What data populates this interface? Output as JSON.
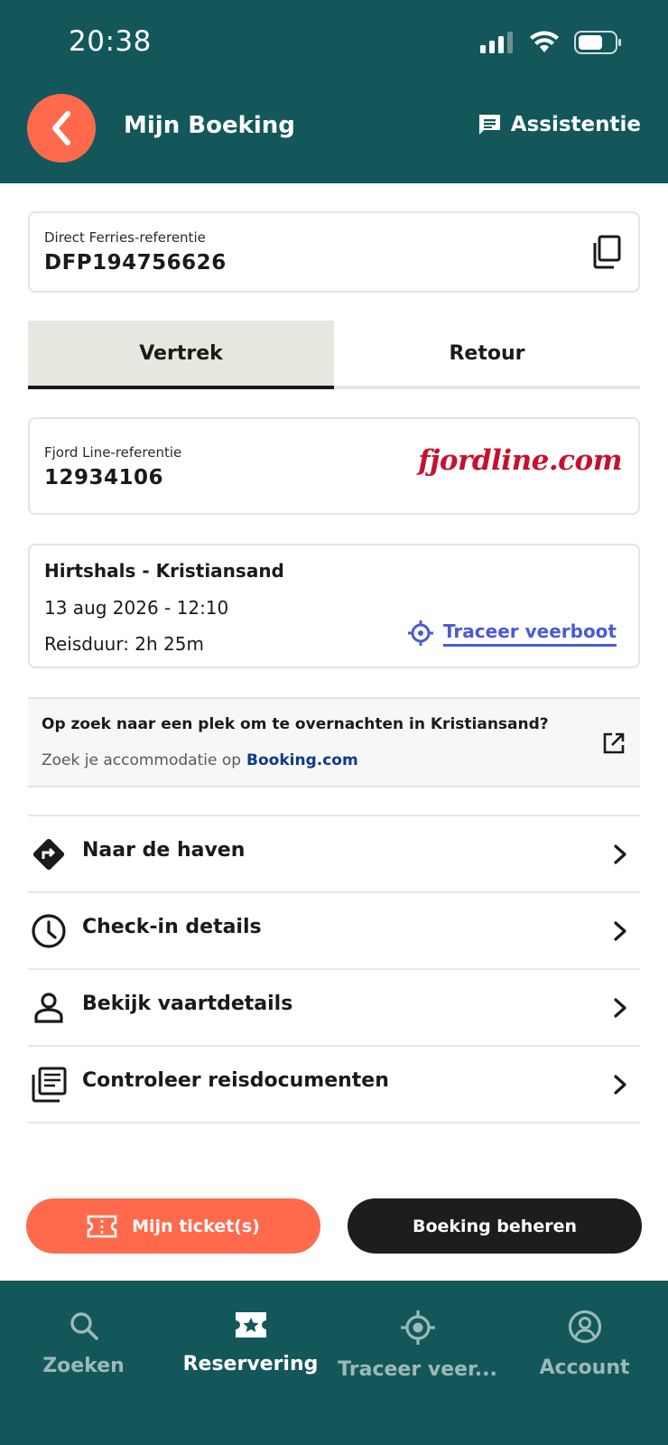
{
  "status_bar": {
    "time": "20:38"
  },
  "header": {
    "title": "Mijn Boeking",
    "assist_label": "Assistentie"
  },
  "reference": {
    "label": "Direct Ferries-referentie",
    "value": "DFP194756626"
  },
  "tabs": [
    {
      "label": "Vertrek",
      "active": true
    },
    {
      "label": "Retour",
      "active": false
    }
  ],
  "operator": {
    "label": "Fjord Line-referentie",
    "value": "12934106",
    "logo_text": "fjordline.com"
  },
  "route": {
    "title": "Hirtshals - Kristiansand",
    "datetime": "13 aug 2026 - 12:10",
    "duration": "Reisduur: 2h 25m",
    "track_label": "Traceer veerboot"
  },
  "promo": {
    "title": "Op zoek naar een plek om te overnachten in Kristiansand?",
    "subtitle": "Zoek je accommodatie op",
    "link": "Booking.com"
  },
  "menu": [
    {
      "label": "Naar de haven",
      "icon": "directions-icon"
    },
    {
      "label": "Check-in details",
      "icon": "clock-icon"
    },
    {
      "label": "Bekijk vaartdetails",
      "icon": "person-icon"
    },
    {
      "label": "Controleer reisdocumenten",
      "icon": "documents-icon"
    }
  ],
  "actions": {
    "ticket_label": "Mijn ticket(s)",
    "manage_label": "Boeking beheren"
  },
  "bottom_nav": [
    {
      "label": "Zoeken",
      "icon": "search-icon",
      "active": false
    },
    {
      "label": "Reservering",
      "icon": "ticket-star-icon",
      "active": true
    },
    {
      "label": "Traceer veer...",
      "icon": "locate-icon",
      "active": false
    },
    {
      "label": "Account",
      "icon": "account-icon",
      "active": false
    }
  ],
  "colors": {
    "header_bg": "#13575a",
    "accent": "#ff6a4d",
    "link_blue": "#4a5bd4",
    "brand_red": "#c8102e",
    "dark_button": "#1d1d1d"
  }
}
